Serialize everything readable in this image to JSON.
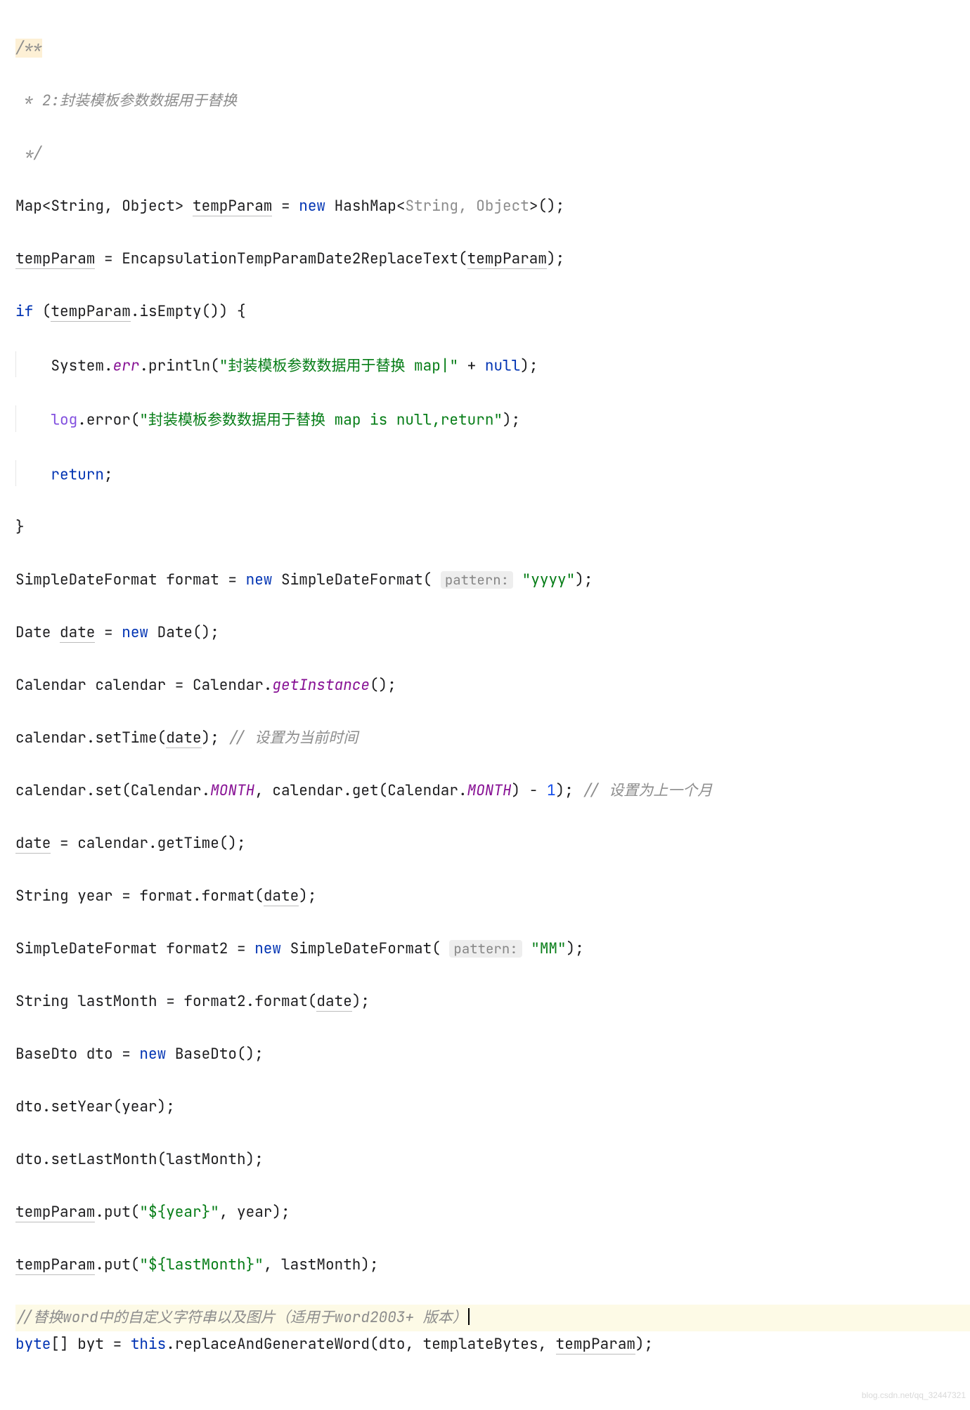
{
  "code": {
    "l1": "/**",
    "l2": " * 2:封装模板参数数据用于替换",
    "l3": " */",
    "l4_p1": "Map<String, Object> ",
    "l4_p2": "tempParam",
    "l4_p3": " = ",
    "l4_new": "new",
    "l4_p4": " HashMap<",
    "l4_grey": "String, Object",
    "l4_p5": ">();",
    "l5_p1": "tempParam",
    "l5_p2": " = EncapsulationTempParamDate2ReplaceText(",
    "l5_p3": "tempParam",
    "l5_p4": ");",
    "l6_if": "if",
    "l6_p1": " (",
    "l6_p2": "tempParam",
    "l6_p3": ".isEmpty()) {",
    "l7_indent": "    ",
    "l7_sys": "System",
    "l7_dot": ".",
    "l7_err": "err",
    "l7_pr": ".println(",
    "l7_str": "\"封装模板参数数据用于替换 map|\"",
    "l7_pl": " + ",
    "l7_null": "null",
    "l7_end": ");",
    "l8_indent": "    ",
    "l8_log": "log",
    "l8_err": ".error(",
    "l8_str": "\"封装模板参数数据用于替换 map is null,return\"",
    "l8_end": ");",
    "l9_indent": "    ",
    "l9_ret": "return",
    "l9_end": ";",
    "l10": "}",
    "l11_p1": "SimpleDateFormat format = ",
    "l11_new": "new",
    "l11_p2": " SimpleDateFormat( ",
    "l11_hint": "pattern:",
    "l11_sp": " ",
    "l11_str": "\"yyyy\"",
    "l11_end": ");",
    "l12_p1": "Date ",
    "l12_date": "date",
    "l12_p2": " = ",
    "l12_new": "new",
    "l12_p3": " Date();",
    "l13_p1": "Calendar calendar = Calendar.",
    "l13_gi": "getInstance",
    "l13_p2": "();",
    "l14_p1": "calendar.setTime(",
    "l14_date": "date",
    "l14_p2": "); ",
    "l14_cmt": "// 设置为当前时间",
    "l15_p1": "calendar.set(Calendar.",
    "l15_m1": "MONTH",
    "l15_p2": ", calendar.get(Calendar.",
    "l15_m2": "MONTH",
    "l15_p3": ") - ",
    "l15_num": "1",
    "l15_p4": "); ",
    "l15_cmt": "// 设置为上一个月",
    "l16_date": "date",
    "l16_p1": " = calendar.getTime();",
    "l17_p1": "String year = format.format(",
    "l17_date": "date",
    "l17_p2": ");",
    "l18_p1": "SimpleDateFormat format2 = ",
    "l18_new": "new",
    "l18_p2": " SimpleDateFormat( ",
    "l18_hint": "pattern:",
    "l18_sp": " ",
    "l18_str": "\"MM\"",
    "l18_end": ");",
    "l19_p1": "String lastMonth = format2.format(",
    "l19_date": "date",
    "l19_p2": ");",
    "l20_p1": "BaseDto dto = ",
    "l20_new": "new",
    "l20_p2": " BaseDto();",
    "l21": "dto.setYear(year);",
    "l22": "dto.setLastMonth(lastMonth);",
    "l23_p1": "tempParam",
    "l23_p2": ".put(",
    "l23_str": "\"${year}\"",
    "l23_p3": ", year);",
    "l24_p1": "tempParam",
    "l24_p2": ".put(",
    "l24_str": "\"${lastMonth}\"",
    "l24_p3": ", lastMonth);",
    "l25_cmt": "//替换word中的自定义字符串以及图片（适用于word2003+ 版本）",
    "l26_byte": "byte",
    "l26_p1": "[] byt = ",
    "l26_this": "this",
    "l26_p2": ".replaceAndGenerateWord(dto, templateBytes, ",
    "l26_tp": "tempParam",
    "l26_p3": ");"
  },
  "watermark": "blog.csdn.net/qq_32447321"
}
